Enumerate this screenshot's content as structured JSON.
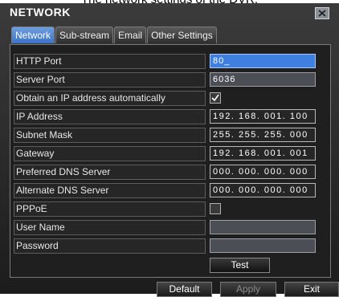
{
  "caption": "The network settings of the DVR.",
  "window": {
    "title": "NETWORK"
  },
  "tabs": [
    {
      "label": "Network",
      "active": true
    },
    {
      "label": "Sub-stream",
      "active": false
    },
    {
      "label": "Email",
      "active": false
    },
    {
      "label": "Other Settings",
      "active": false
    }
  ],
  "form": {
    "http_port": {
      "label": "HTTP Port",
      "value": "80_"
    },
    "server_port": {
      "label": "Server Port",
      "value": "6036"
    },
    "obtain_ip": {
      "label": "Obtain an IP address automatically",
      "checked": true
    },
    "ip_address": {
      "label": "IP Address",
      "value": "192. 168. 001. 100"
    },
    "subnet_mask": {
      "label": "Subnet Mask",
      "value": "255. 255. 255. 000"
    },
    "gateway": {
      "label": "Gateway",
      "value": "192. 168. 001. 001"
    },
    "preferred_dns": {
      "label": "Preferred DNS Server",
      "value": "000. 000. 000. 000"
    },
    "alternate_dns": {
      "label": "Alternate DNS Server",
      "value": "000. 000. 000. 000"
    },
    "pppoe": {
      "label": "PPPoE",
      "checked": false
    },
    "user_name": {
      "label": "User Name",
      "value": ""
    },
    "password": {
      "label": "Password",
      "value": ""
    },
    "test_label": "Test"
  },
  "footer": {
    "default_label": "Default",
    "apply_label": "Apply",
    "exit_label": "Exit"
  },
  "colors": {
    "tab_active": "#3a73c6",
    "field_active": "#3f7fe0",
    "background": "#1f1f1f"
  },
  "icons": {
    "close": "close-icon",
    "checkmark": "check-icon"
  }
}
